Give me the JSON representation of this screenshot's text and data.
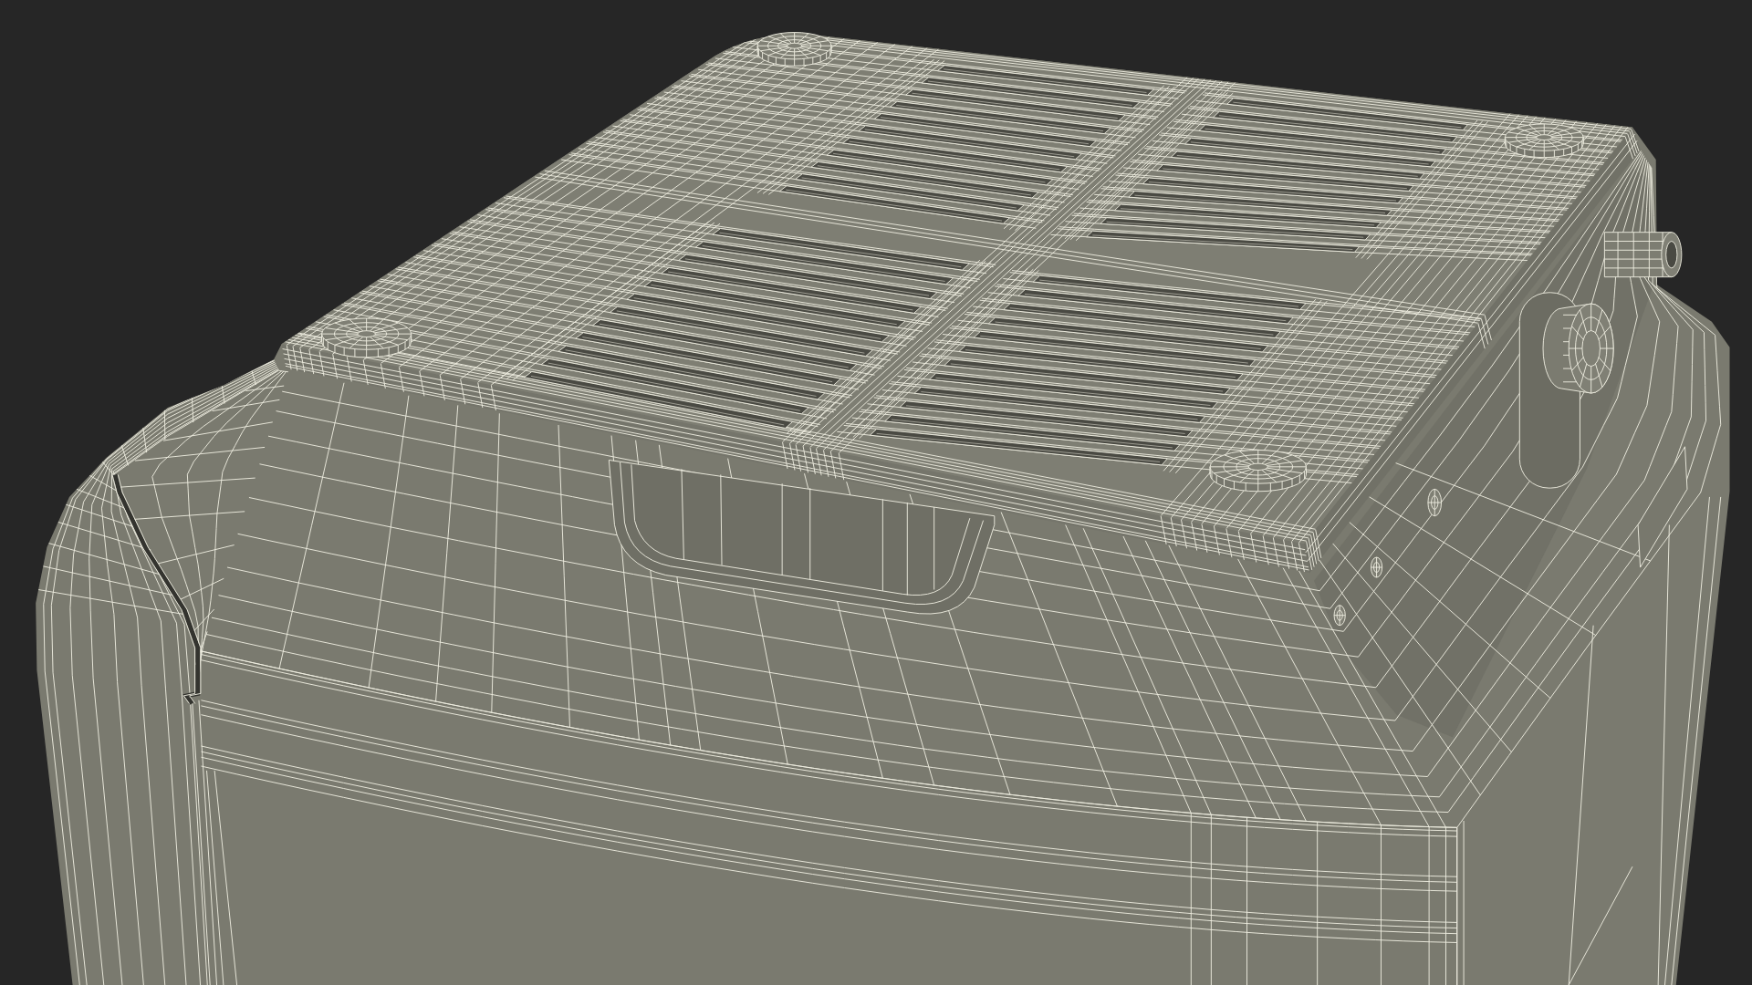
{
  "model_view": {
    "kind": "wireframe"
  }
}
